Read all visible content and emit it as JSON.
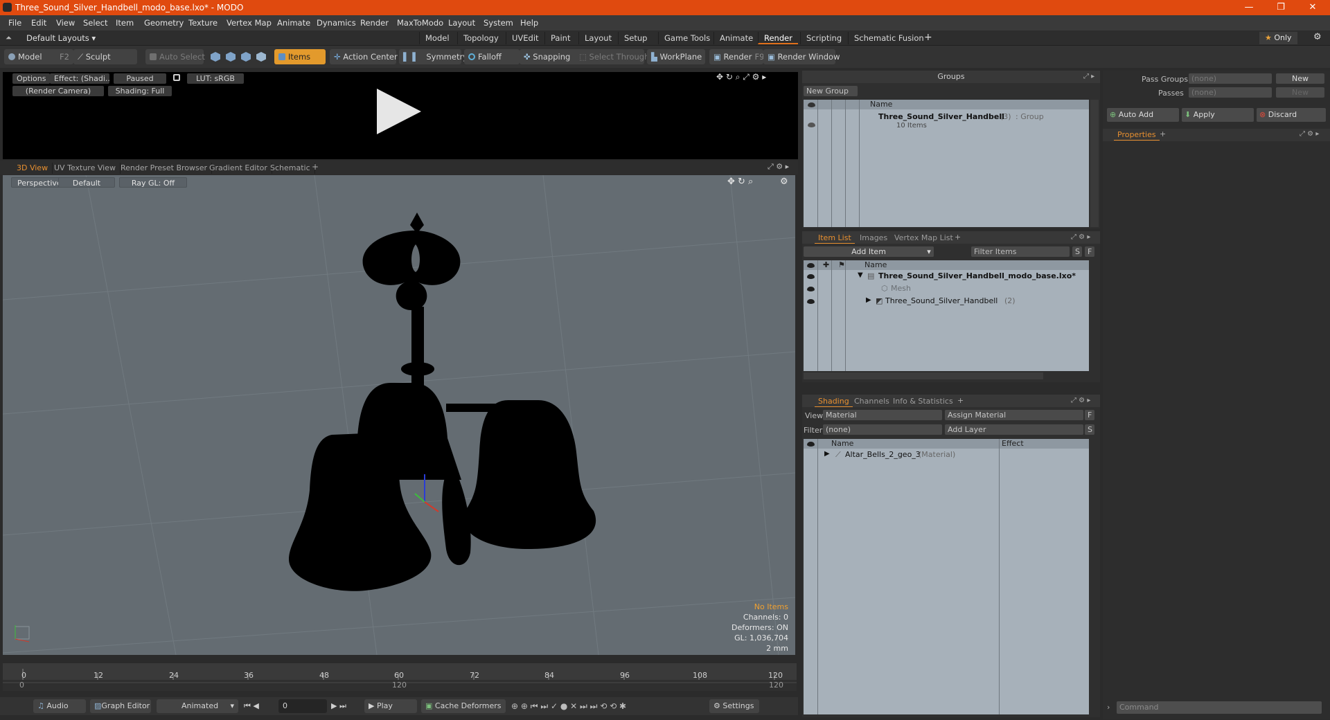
{
  "window": {
    "title": "Three_Sound_Silver_Handbell_modo_base.lxo* - MODO",
    "minimize": "—",
    "restore": "❐",
    "close": "✕"
  },
  "menu": [
    "File",
    "Edit",
    "View",
    "Select",
    "Item",
    "Geometry",
    "Texture",
    "Vertex Map",
    "Animate",
    "Dynamics",
    "Render",
    "MaxToModo",
    "Layout",
    "System",
    "Help"
  ],
  "layoutbar": {
    "layouts_label": "Default Layouts",
    "tabs": [
      "Model",
      "Topology",
      "UVEdit",
      "Paint",
      "Layout",
      "Setup",
      "Game Tools",
      "Animate",
      "Render",
      "Scripting",
      "Schematic Fusion"
    ],
    "active_tab": "Render",
    "add": "+",
    "only_label": "Only"
  },
  "toolbar": {
    "model": "Model",
    "model_key": "F2",
    "sculpt": "Sculpt",
    "auto_select": "Auto Select",
    "items": "Items",
    "action_center": "Action Center",
    "symmetry": "Symmetry",
    "falloff": "Falloff",
    "snapping": "Snapping",
    "select_through": "Select Through",
    "workplane": "WorkPlane",
    "render": "Render",
    "render_key": "F9",
    "render_window": "Render Window"
  },
  "preview": {
    "options": "Options",
    "effect": "Effect: (Shadi...",
    "paused": "Paused",
    "lut": "LUT: sRGB",
    "camera": "(Render Camera)",
    "shading": "Shading: Full"
  },
  "viewport_tabs": [
    "3D View",
    "UV Texture View",
    "Render Preset Browser",
    "Gradient Editor",
    "Schematic"
  ],
  "viewport": {
    "perspective": "Perspective",
    "default": "Default",
    "raygl": "Ray GL: Off",
    "info": [
      "No Items",
      "Channels: 0",
      "Deformers: ON",
      "GL: 1,036,704",
      "2 mm"
    ]
  },
  "timeline": {
    "ticks": [
      "0",
      "12",
      "24",
      "36",
      "48",
      "60",
      "72",
      "84",
      "96",
      "108",
      "120"
    ],
    "sub_start": "0",
    "sub_mid": "120",
    "sub_end": "120"
  },
  "bottombar": {
    "audio": "Audio",
    "graph_editor": "Graph Editor",
    "animated": "Animated",
    "frame": "0",
    "play": "Play",
    "cache_deformers": "Cache Deformers",
    "settings": "Settings"
  },
  "groups": {
    "title": "Groups",
    "new_group": "New Group",
    "col_name": "Name",
    "item_name": "Three_Sound_Silver_Handbell",
    "item_count": "(3)",
    "item_type": ": Group",
    "item_sub": "10 Items"
  },
  "passes": {
    "pass_groups_label": "Pass Groups",
    "pass_groups_value": "(none)",
    "passes_label": "Passes",
    "passes_value": "(none)",
    "new": "New",
    "new2": "New",
    "auto_add": "Auto Add",
    "apply": "Apply",
    "discard": "Discard",
    "properties": "Properties"
  },
  "itemlist": {
    "tabs": [
      "Item List",
      "Images",
      "Vertex Map List"
    ],
    "add_item": "Add Item",
    "filter": "Filter Items",
    "s": "S",
    "f": "F",
    "col_name": "Name",
    "rows": [
      {
        "name": "Three_Sound_Silver_Handbell_modo_base.lxo*",
        "extra": ""
      },
      {
        "name": "Mesh",
        "extra": ""
      },
      {
        "name": "Three_Sound_Silver_Handbell",
        "extra": "(2)"
      }
    ]
  },
  "shading": {
    "tabs": [
      "Shading",
      "Channels",
      "Info & Statistics"
    ],
    "view_label": "View",
    "view_value": "Material",
    "assign": "Assign Material",
    "filter_label": "Filter",
    "filter_value": "(none)",
    "add_layer": "Add Layer",
    "f": "F",
    "s": "S",
    "col_name": "Name",
    "col_effect": "Effect",
    "row_name": "Altar_Bells_2_geo_3",
    "row_type": "(Material)"
  },
  "command": {
    "placeholder": "Command"
  }
}
